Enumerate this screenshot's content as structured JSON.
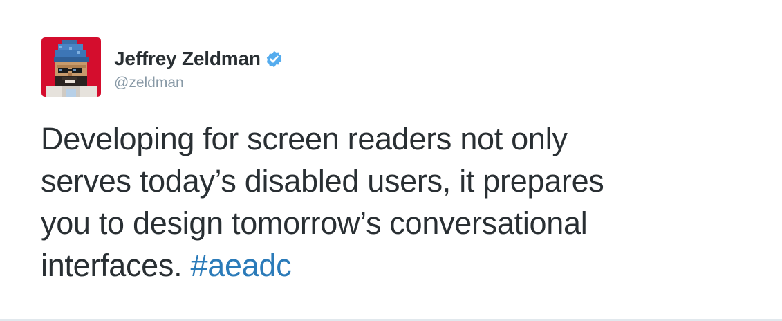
{
  "author": {
    "display_name": "Jeffrey Zeldman",
    "handle": "@zeldman",
    "verified": true,
    "avatar_icon": "pixel-art-avatar-icon",
    "verified_icon": "verified-badge-icon"
  },
  "tweet": {
    "lines": [
      "Developing for screen readers not only",
      "serves today’s disabled users, it prepares",
      "you to design tomorrow’s conversational",
      "interfaces. "
    ],
    "hashtag": "#aeadc"
  },
  "colors": {
    "text": "#292f33",
    "secondary": "#8899a6",
    "link": "#2b7bb9",
    "verified": "#55acee",
    "avatar_bg": "#d40d2d"
  }
}
